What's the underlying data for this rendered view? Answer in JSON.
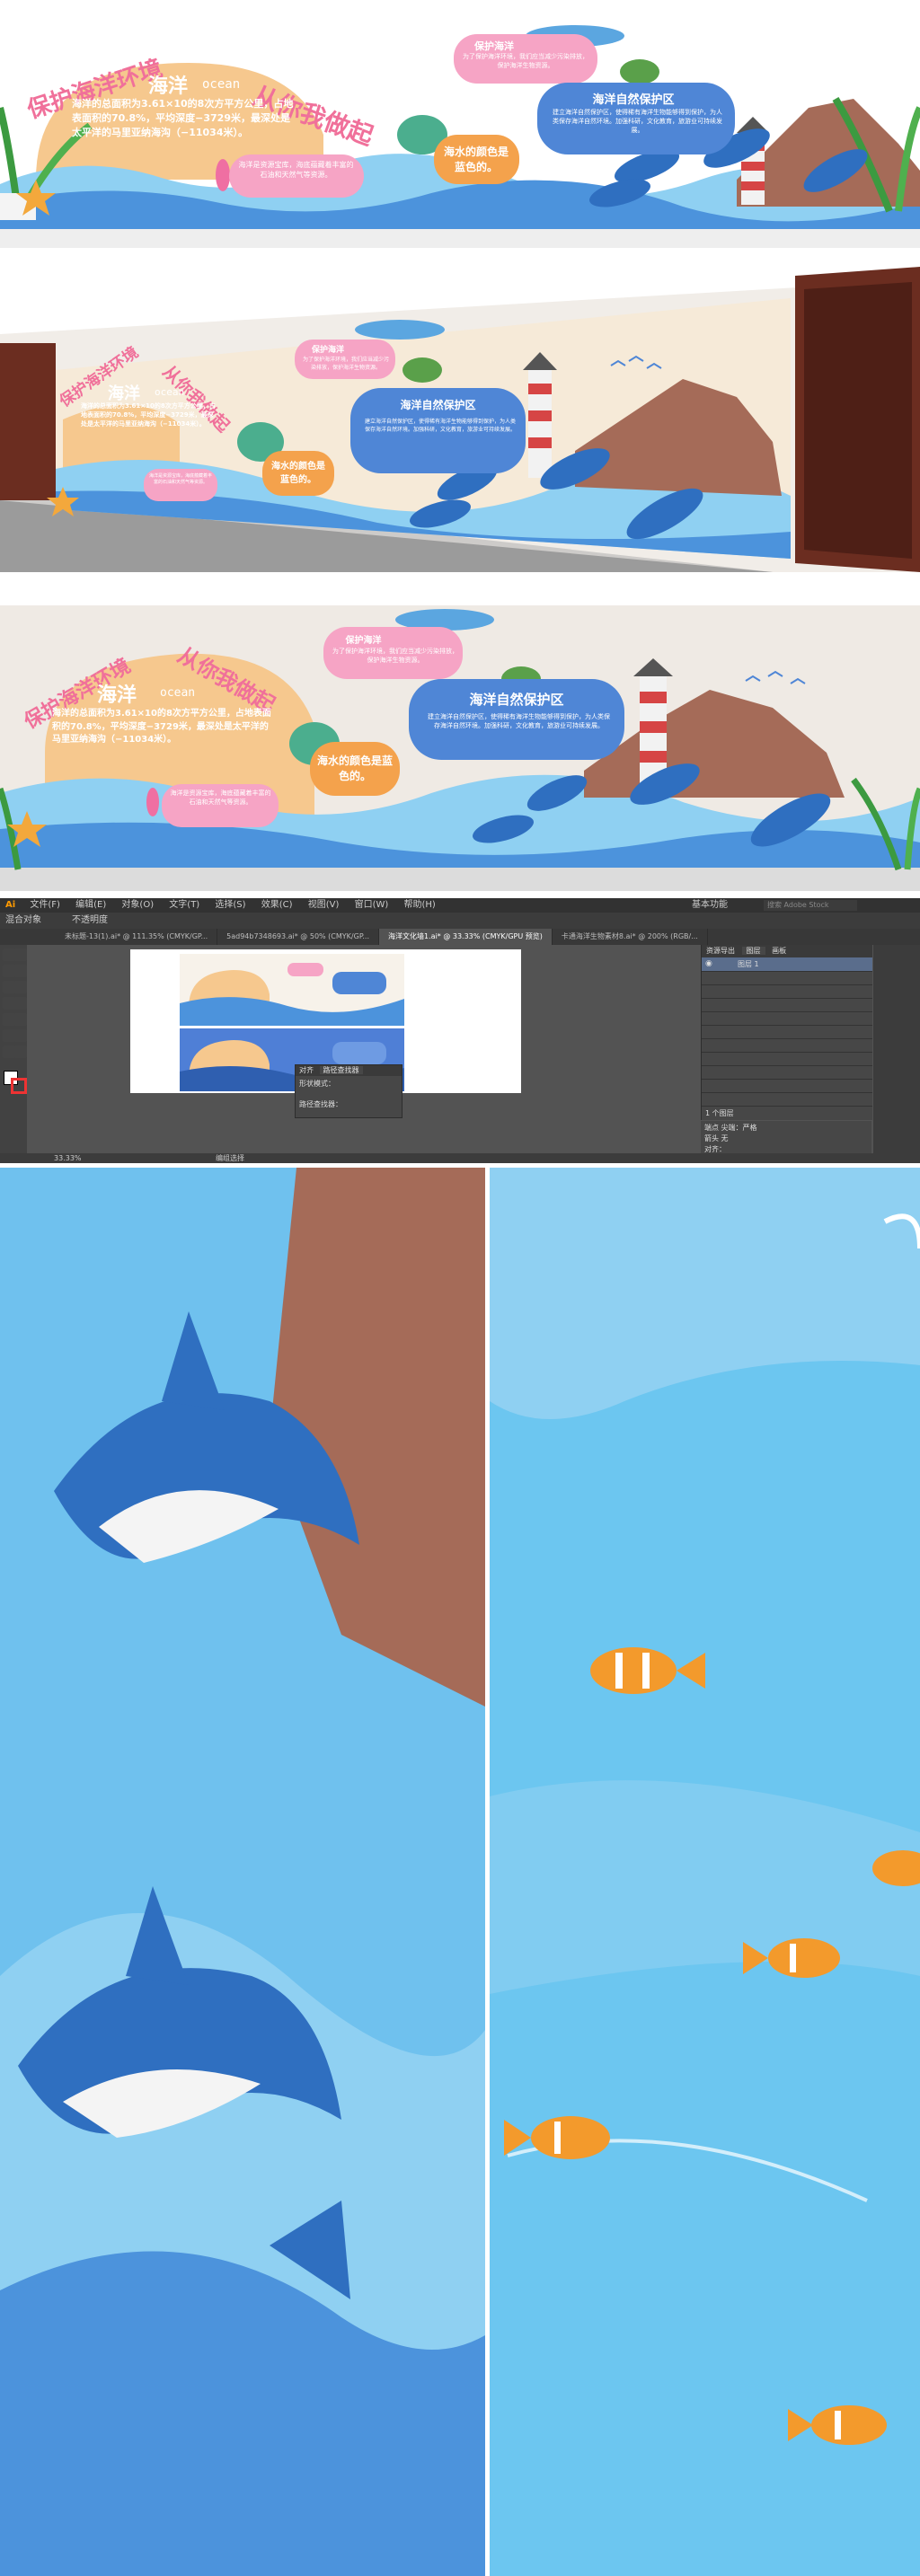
{
  "board": {
    "title_left": "保护海洋环境",
    "title_right": "从你我做起",
    "ocean_cn": "海洋",
    "ocean_en": "ocean",
    "intro": "海洋的总面积为3.61×10的8次方平方公里，占地表面积的70.8%，平均深度−3729米，最深处是太平洋的马里亚纳海沟（−11034米）。",
    "seahorse_text": "海洋是资源宝库，海底蕴藏着丰富的石油和天然气等资源。",
    "protect_title": "保护海洋",
    "protect_text": "为了保护海洋环境，我们应当减少污染排放，保护海洋生物资源。",
    "reserve_title": "海洋自然保护区",
    "reserve_text": "建立海洋自然保护区，使得稀有海洋生物能够得到保护，为人类保存海洋自然环境。加强科研，文化教育，旅游业可持续发展。",
    "color_text": "海水的颜色是蓝色的。"
  },
  "colors": {
    "title_pink": "#f0709a",
    "sun_orange": "#f6c88e",
    "cloud_pink": "#f6a4c5",
    "cloud_blue": "#4f86d6",
    "cloud_orange": "#f4a24c",
    "sea_light": "#8fd0f2",
    "sea_dark": "#2f6fc0",
    "ai_bg": "#535353"
  },
  "ai": {
    "menu": [
      "文件(F)",
      "编辑(E)",
      "对象(O)",
      "文字(T)",
      "选择(S)",
      "效果(C)",
      "视图(V)",
      "窗口(W)",
      "帮助(H)"
    ],
    "workspace": "基本功能",
    "tabs": [
      "未标题-13(1).ai* @ 111.35% (CMYK/GP...",
      "5ad94b7348693.ai* @ 50% (CMYK/GP...",
      "海洋文化墙1.ai* @ 33.33% (CMYK/GPU 预览)",
      "卡通海洋生物素材8.ai* @ 200% (RGB/..."
    ],
    "toolbar_left": "混合对象",
    "opacity_label": "不透明度",
    "panel_path_title": "路径查找器",
    "panel_align": "对齐",
    "panel_shape_modes": "形状模式：",
    "panel_pathfinders": "路径查找器：",
    "layers_tab1": "资源导出",
    "layers_tab2": "图层",
    "layers_tab3": "画板",
    "layer_name": "图层 1",
    "layers_count": "1 个图层",
    "dash_label": "端点",
    "dash_value": "尖端：严格",
    "arrow_label": "箭头",
    "arrow_value": "无",
    "align_label": "对齐：",
    "status_zoom": "33.33%",
    "status_text": "编组选择",
    "search_placeholder": "搜索 Adobe Stock"
  }
}
